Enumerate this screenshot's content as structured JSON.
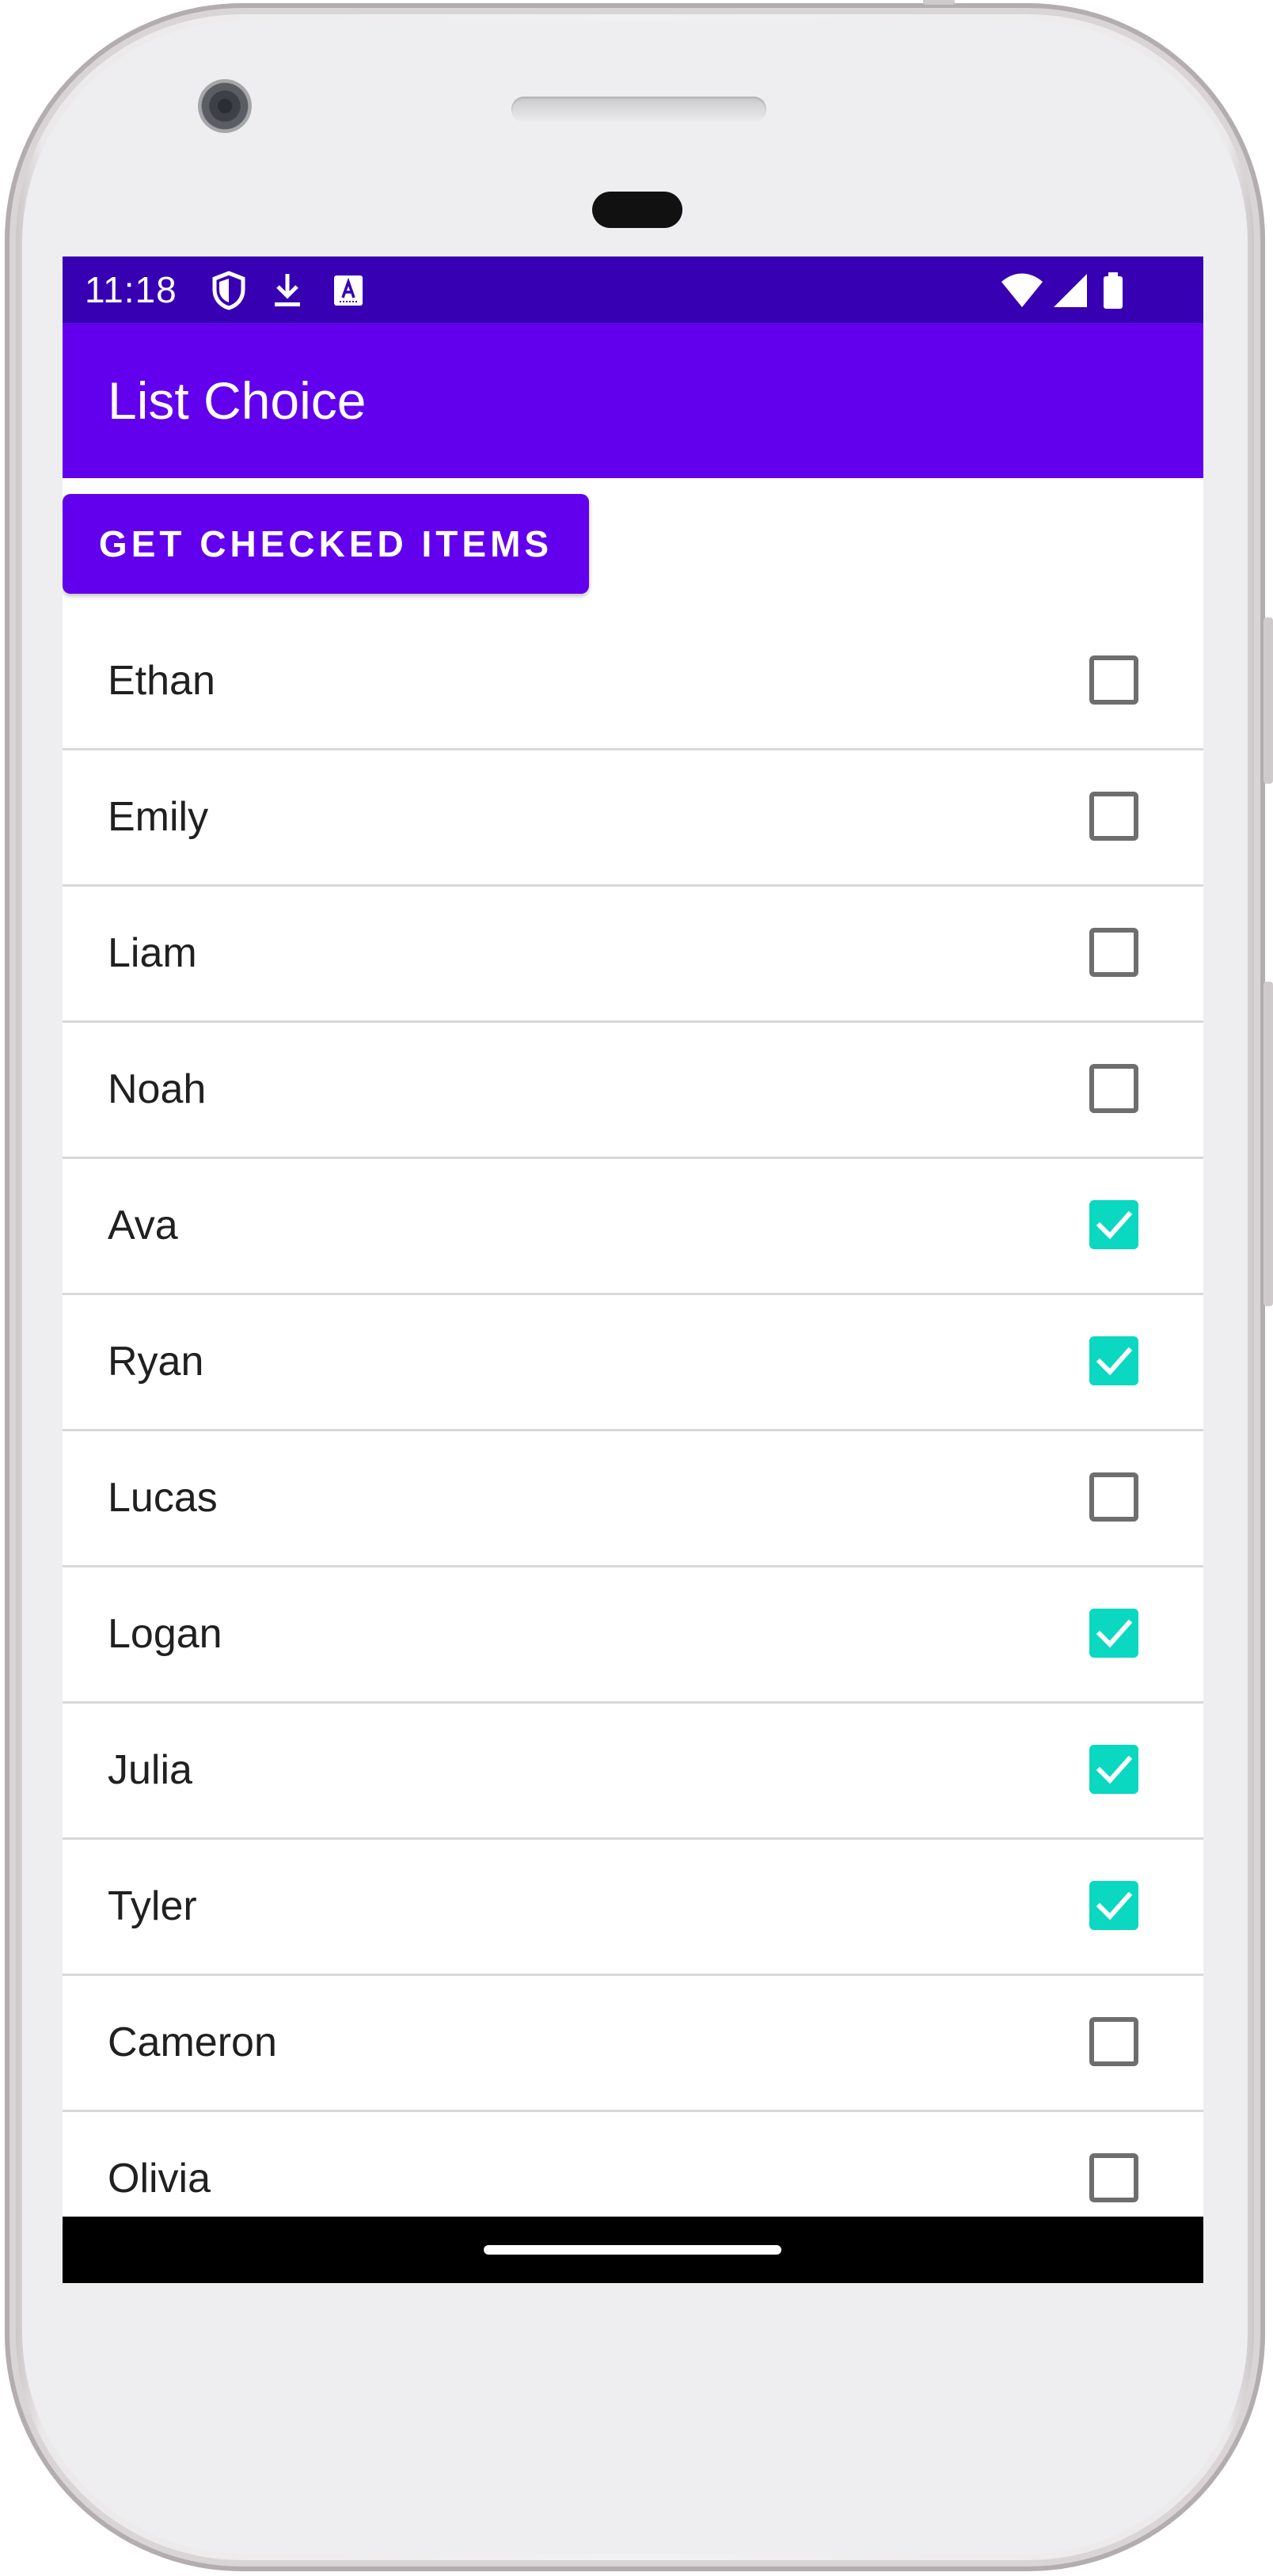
{
  "device": {
    "frame_color": "#ecebed",
    "accent": "#6200ee"
  },
  "status_bar": {
    "time": "11:18",
    "left_icons": [
      "shield-icon",
      "download-icon",
      "text-recognition-icon"
    ],
    "right_icons": [
      "wifi-icon",
      "signal-icon",
      "battery-icon"
    ],
    "background": "#3700b3"
  },
  "app_bar": {
    "title": "List Choice",
    "background": "#6200ee"
  },
  "main": {
    "action_button_label": "GET CHECKED ITEMS",
    "items": [
      {
        "label": "Ethan",
        "checked": false
      },
      {
        "label": "Emily",
        "checked": false
      },
      {
        "label": "Liam",
        "checked": false
      },
      {
        "label": "Noah",
        "checked": false
      },
      {
        "label": "Ava",
        "checked": true
      },
      {
        "label": "Ryan",
        "checked": true
      },
      {
        "label": "Lucas",
        "checked": false
      },
      {
        "label": "Logan",
        "checked": true
      },
      {
        "label": "Julia",
        "checked": true
      },
      {
        "label": "Tyler",
        "checked": true
      },
      {
        "label": "Cameron",
        "checked": false
      },
      {
        "label": "Olivia",
        "checked": false
      }
    ],
    "checked_color": "#0bd8c0",
    "unchecked_color": "#6e6e6e"
  },
  "nav_bar": {
    "home_indicator": "home-pill-icon"
  }
}
